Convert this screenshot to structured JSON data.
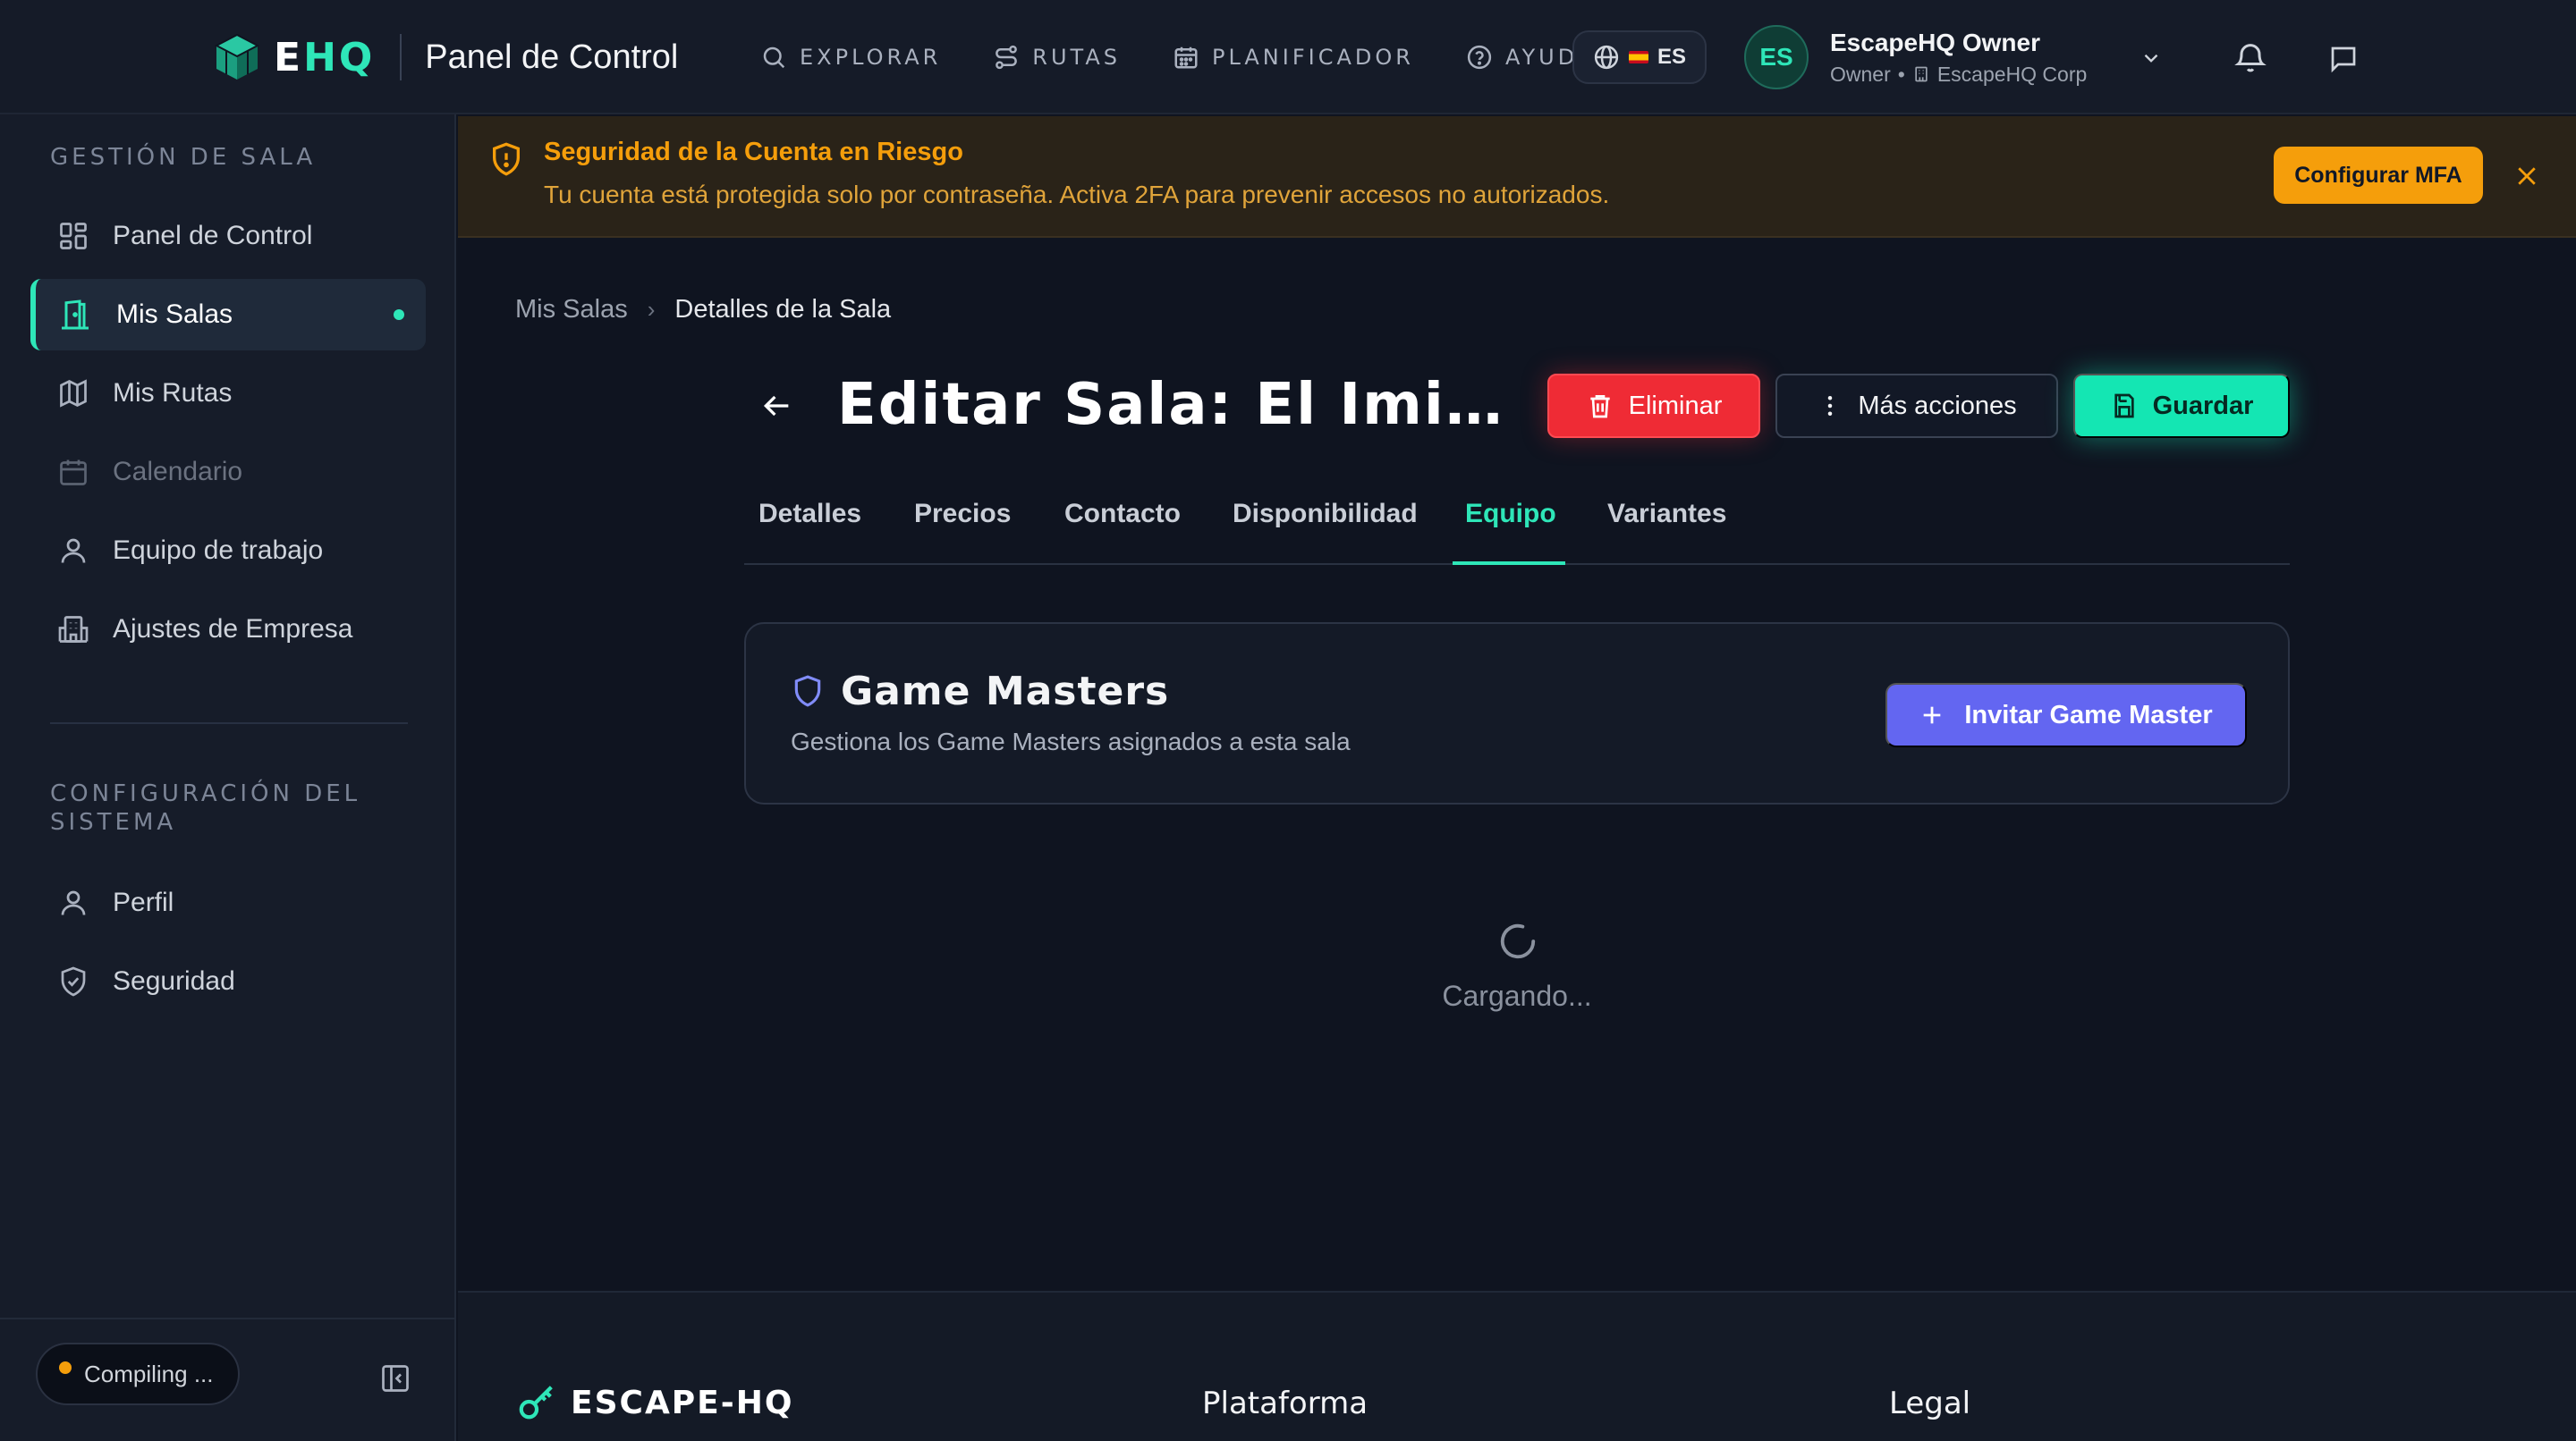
{
  "brand": {
    "logo_e": "E",
    "logo_hq": "HQ",
    "title": "Panel de Control"
  },
  "topnav": [
    {
      "label": "EXPLORAR",
      "icon": "search-icon"
    },
    {
      "label": "RUTAS",
      "icon": "route-icon"
    },
    {
      "label": "PLANIFICADOR",
      "icon": "calendar-icon"
    },
    {
      "label": "AYUDA",
      "icon": "help-icon"
    }
  ],
  "language": {
    "code": "ES"
  },
  "user": {
    "initials": "ES",
    "name": "EscapeHQ Owner",
    "role": "Owner",
    "separator": "•",
    "company": "EscapeHQ Corp"
  },
  "sidebar": {
    "section1": "GESTIÓN DE SALA",
    "items1": [
      {
        "label": "Panel de Control",
        "icon": "dashboard-icon"
      },
      {
        "label": "Mis Salas",
        "icon": "door-icon"
      },
      {
        "label": "Mis Rutas",
        "icon": "map-icon"
      },
      {
        "label": "Calendario",
        "icon": "calendar-icon"
      },
      {
        "label": "Equipo de trabajo",
        "icon": "user-icon"
      },
      {
        "label": "Ajustes de Empresa",
        "icon": "building-icon"
      }
    ],
    "section2": "CONFIGURACIÓN DEL SISTEMA",
    "items2": [
      {
        "label": "Perfil",
        "icon": "user-icon"
      },
      {
        "label": "Seguridad",
        "icon": "shield-check-icon"
      }
    ],
    "status": "Compiling ..."
  },
  "alert": {
    "title": "Seguridad de la Cuenta en Riesgo",
    "text": "Tu cuenta está protegida solo por contraseña. Activa 2FA para prevenir accesos no autorizados.",
    "button": "Configurar MFA"
  },
  "breadcrumb": {
    "parent": "Mis Salas",
    "separator": "›",
    "current": "Detalles de la Sala"
  },
  "page": {
    "title": "Editar Sala: El Imitador"
  },
  "actions": {
    "delete": "Eliminar",
    "more": "Más acciones",
    "save": "Guardar"
  },
  "tabs": [
    "Detalles",
    "Precios",
    "Contacto",
    "Disponibilidad",
    "Equipo",
    "Variantes"
  ],
  "active_tab": "Equipo",
  "card": {
    "title": "Game Masters",
    "subtitle": "Gestiona los Game Masters asignados a esta sala",
    "invite": "Invitar Game Master"
  },
  "loading": "Cargando...",
  "footer": {
    "logo": "ESCAPE-HQ",
    "col1": "Plataforma",
    "col2": "Legal"
  },
  "colors": {
    "accent": "#2ee6b8",
    "danger": "#ef2b35",
    "warning": "#f59e0b",
    "primary": "#6366f1"
  }
}
